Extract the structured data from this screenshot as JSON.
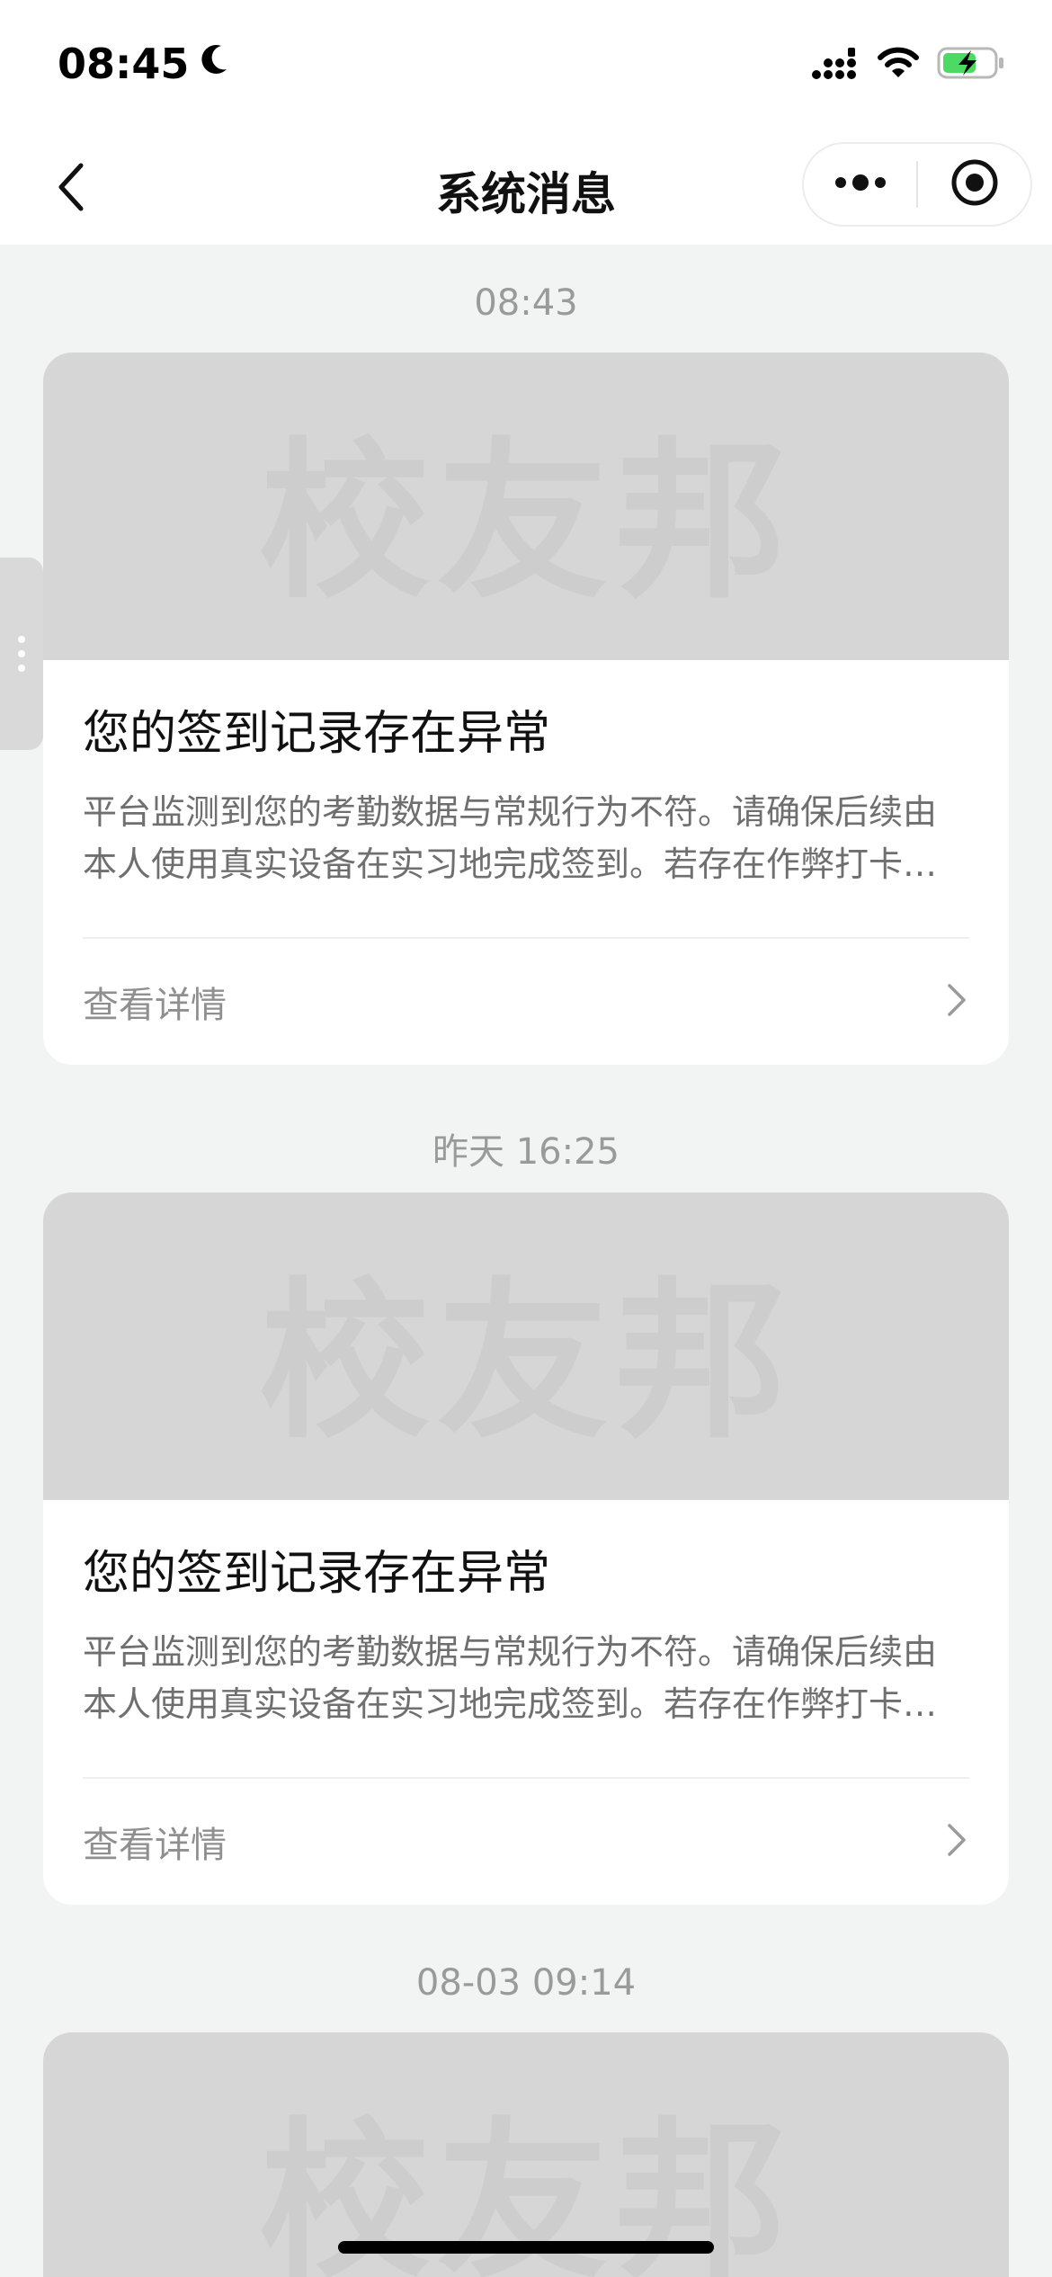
{
  "status_bar": {
    "time": "08:45"
  },
  "nav": {
    "title": "系统消息"
  },
  "watermark_text": "校友邦",
  "messages": [
    {
      "timestamp": "08:43",
      "title": "您的签到记录存在异常",
      "description": "平台监测到您的考勤数据与常规行为不符。请确保后续由本人使用真实设备在实习地完成签到。若存在作弊打卡…",
      "link_label": "查看详情"
    },
    {
      "timestamp": "昨天 16:25",
      "title": "您的签到记录存在异常",
      "description": "平台监测到您的考勤数据与常规行为不符。请确保后续由本人使用真实设备在实习地完成签到。若存在作弊打卡…",
      "link_label": "查看详情"
    },
    {
      "timestamp": "08-03 09:14"
    }
  ],
  "colors": {
    "page_bg": "#f2f3f3",
    "banner_bg": "#d6d6d6",
    "battery_green": "#4cd964"
  }
}
